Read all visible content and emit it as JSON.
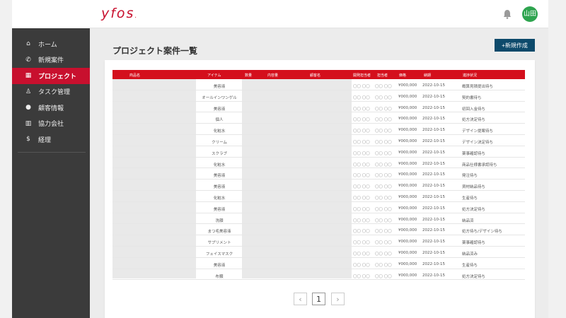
{
  "app": {
    "logo": "yfos",
    "user_avatar": "山田"
  },
  "sidebar": {
    "items": [
      {
        "label": "ホーム",
        "icon": "home-icon",
        "glyph": "⌂"
      },
      {
        "label": "新規案件",
        "icon": "phone-icon",
        "glyph": "✆"
      },
      {
        "label": "プロジェクト",
        "icon": "dashboard-icon",
        "glyph": "▦"
      },
      {
        "label": "タスク管理",
        "icon": "person-badge-icon",
        "glyph": "♙"
      },
      {
        "label": "顧客情報",
        "icon": "person-icon",
        "glyph": "●"
      },
      {
        "label": "協力会社",
        "icon": "building-icon",
        "glyph": "▥"
      },
      {
        "label": "経理",
        "icon": "dollar-icon",
        "glyph": "$"
      }
    ]
  },
  "main": {
    "title": "プロジェクト案件一覧",
    "new_button": "+新規作成",
    "columns": [
      "商品名",
      "アイテム",
      "数量",
      "内容量",
      "顧客名",
      "開発担当者",
      "担当者",
      "価格",
      "納期",
      "進捗状況"
    ],
    "rows": [
      {
        "item": "美容液",
        "person1": "〇〇 〇〇",
        "person2": "〇〇 〇〇",
        "price": "¥000,000",
        "date": "2022-10-15",
        "status": "概算見積提出待ち"
      },
      {
        "item": "オールインワンゲル",
        "person1": "〇〇 〇〇",
        "person2": "〇〇 〇〇",
        "price": "¥000,000",
        "date": "2022-10-15",
        "status": "契約書待ち"
      },
      {
        "item": "美容液",
        "person1": "〇〇 〇〇",
        "person2": "〇〇 〇〇",
        "price": "¥000,000",
        "date": "2022-10-15",
        "status": "初回入金待ち"
      },
      {
        "item": "個人",
        "person1": "〇〇 〇〇",
        "person2": "〇〇 〇〇",
        "price": "¥000,000",
        "date": "2022-10-15",
        "status": "処方決定待ち"
      },
      {
        "item": "化粧水",
        "person1": "〇〇 〇〇",
        "person2": "〇〇 〇〇",
        "price": "¥000,000",
        "date": "2022-10-15",
        "status": "デザイン提案待ち"
      },
      {
        "item": "クリーム",
        "person1": "〇〇 〇〇",
        "person2": "〇〇 〇〇",
        "price": "¥000,000",
        "date": "2022-10-15",
        "status": "デザイン決定待ち"
      },
      {
        "item": "スクラブ",
        "person1": "〇〇 〇〇",
        "person2": "〇〇 〇〇",
        "price": "¥000,000",
        "date": "2022-10-15",
        "status": "薬事確認待ち"
      },
      {
        "item": "化粧水",
        "person1": "〇〇 〇〇",
        "person2": "〇〇 〇〇",
        "price": "¥000,000",
        "date": "2022-10-15",
        "status": "商品仕様書承認待ち"
      },
      {
        "item": "美容液",
        "person1": "〇〇 〇〇",
        "person2": "〇〇 〇〇",
        "price": "¥000,000",
        "date": "2022-10-15",
        "status": "発注待ち"
      },
      {
        "item": "美容液",
        "person1": "〇〇 〇〇",
        "person2": "〇〇 〇〇",
        "price": "¥000,000",
        "date": "2022-10-15",
        "status": "資材納品待ち"
      },
      {
        "item": "化粧水",
        "person1": "〇〇 〇〇",
        "person2": "〇〇 〇〇",
        "price": "¥000,000",
        "date": "2022-10-15",
        "status": "生産待ち"
      },
      {
        "item": "美容液",
        "person1": "〇〇 〇〇",
        "person2": "〇〇 〇〇",
        "price": "¥000,000",
        "date": "2022-10-15",
        "status": "処方決定待ち"
      },
      {
        "item": "洗顔",
        "person1": "〇〇 〇〇",
        "person2": "〇〇 〇〇",
        "price": "¥000,000",
        "date": "2022-10-15",
        "status": "納品済"
      },
      {
        "item": "まつ毛美容液",
        "person1": "〇〇 〇〇",
        "person2": "〇〇 〇〇",
        "price": "¥000,000",
        "date": "2022-10-15",
        "status": "処方待ち/デザイン待ち"
      },
      {
        "item": "サプリメント",
        "person1": "〇〇 〇〇",
        "person2": "〇〇 〇〇",
        "price": "¥000,000",
        "date": "2022-10-15",
        "status": "薬事確認待ち"
      },
      {
        "item": "フェイスマスク",
        "person1": "〇〇 〇〇",
        "person2": "〇〇 〇〇",
        "price": "¥000,000",
        "date": "2022-10-15",
        "status": "納品済み"
      },
      {
        "item": "美容液",
        "person1": "〇〇 〇〇",
        "person2": "〇〇 〇〇",
        "price": "¥000,000",
        "date": "2022-10-15",
        "status": "生産待ち"
      },
      {
        "item": "布類",
        "person1": "〇〇 〇〇",
        "person2": "〇〇 〇〇",
        "price": "¥000,000",
        "date": "2022-10-15",
        "status": "処方決定待ち"
      }
    ]
  },
  "pagination": {
    "prev": "‹",
    "current": "1",
    "next": "›"
  },
  "colors": {
    "brand_red": "#c8102e",
    "header_red": "#d40f1c",
    "button_blue": "#0d4a6b",
    "avatar_green": "#2ea44f",
    "sidebar_bg": "#3b3b3b"
  }
}
